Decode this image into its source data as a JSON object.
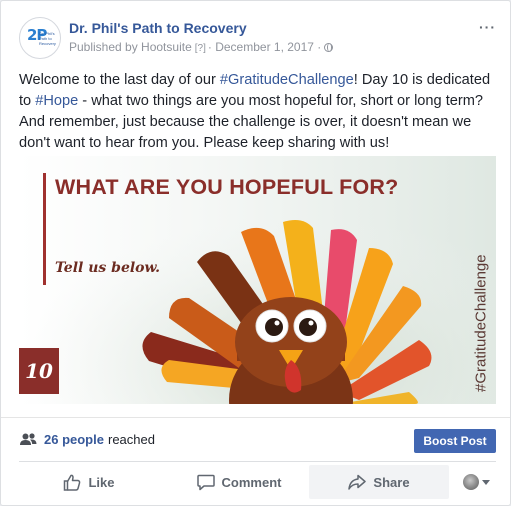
{
  "post": {
    "page_name": "Dr. Phil's Path to Recovery",
    "avatar": {
      "mark": "2P",
      "line1": "Dr. Phil's",
      "line2": "Path to Recovery"
    },
    "published_by": "Published by Hootsuite",
    "help_marker": "[?]",
    "separator": "·",
    "date": "December 1, 2017",
    "audience_icon": "globe-icon",
    "more_label": "···",
    "text": {
      "part1": "Welcome to the last day of our ",
      "tag1": "#GratitudeChallenge",
      "part2": "! Day 10 is dedicated to ",
      "tag2": "#Hope",
      "part3": " - what two things are you most hopeful for, short or long term? And remember, just because the challenge is over, it doesn't mean we don't want to hear from you. Please keep sharing with us!"
    },
    "image": {
      "title": "WHAT ARE YOU HOPEFUL FOR?",
      "subtitle": "Tell us below.",
      "day_number": "10",
      "hashtag": "#GratitudeChallenge",
      "accent_color": "#8a2e2a"
    }
  },
  "reach": {
    "count": "26 people",
    "label": "reached",
    "boost_label": "Boost Post"
  },
  "actions": {
    "like": "Like",
    "comment": "Comment",
    "share": "Share"
  },
  "colors": {
    "link": "#365899",
    "button": "#4267b2",
    "muted": "#90949c"
  }
}
